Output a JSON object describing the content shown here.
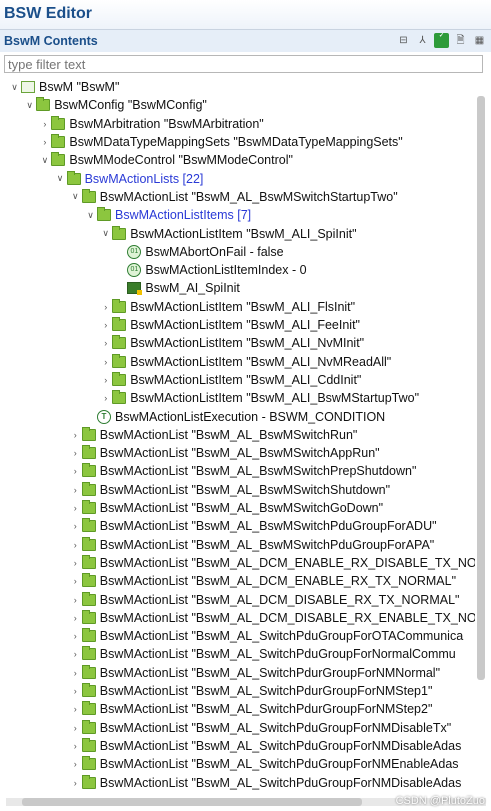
{
  "window": {
    "title": "BSW Editor"
  },
  "panel": {
    "title": "BswM Contents",
    "filter_placeholder": "type filter text"
  },
  "toolbar_icons": [
    "collapse-icon",
    "link-icon",
    "validate-icon",
    "file-icon",
    "layout-icon"
  ],
  "toolbar_labels": [
    "⊟",
    "⅄",
    "✓",
    "🗎",
    "▦"
  ],
  "tree": [
    {
      "label": "BswM \"BswM\"",
      "indent": 0,
      "tw": "∨",
      "icon": "container"
    },
    {
      "label": "BswMConfig \"BswMConfig\"",
      "indent": 1,
      "tw": "∨",
      "icon": "folder"
    },
    {
      "label": "BswMArbitration \"BswMArbitration\"",
      "indent": 2,
      "tw": "›",
      "icon": "folder"
    },
    {
      "label": "BswMDataTypeMappingSets \"BswMDataTypeMappingSets\"",
      "indent": 2,
      "tw": "›",
      "icon": "folder"
    },
    {
      "label": "BswMModeControl \"BswMModeControl\"",
      "indent": 2,
      "tw": "∨",
      "icon": "folder"
    },
    {
      "label": "BswMActionLists [22]",
      "indent": 3,
      "tw": "∨",
      "icon": "folder",
      "blue": true
    },
    {
      "label": "BswMActionList \"BswM_AL_BswMSwitchStartupTwo\"",
      "indent": 4,
      "tw": "∨",
      "icon": "folder"
    },
    {
      "label": "BswMActionListItems [7]",
      "indent": 5,
      "tw": "∨",
      "icon": "folder",
      "blue": true
    },
    {
      "label": "BswMActionListItem \"BswM_ALI_SpiInit\"",
      "indent": 6,
      "tw": "∨",
      "icon": "folder"
    },
    {
      "label": "BswMAbortOnFail - false",
      "indent": 7,
      "tw": "",
      "icon": "param"
    },
    {
      "label": "BswMActionListItemIndex - 0",
      "indent": 7,
      "tw": "",
      "icon": "param"
    },
    {
      "label": "BswM_AI_SpiInit",
      "indent": 7,
      "tw": "",
      "icon": "ref"
    },
    {
      "label": "BswMActionListItem \"BswM_ALI_FlsInit\"",
      "indent": 6,
      "tw": "›",
      "icon": "folder"
    },
    {
      "label": "BswMActionListItem \"BswM_ALI_FeeInit\"",
      "indent": 6,
      "tw": "›",
      "icon": "folder"
    },
    {
      "label": "BswMActionListItem \"BswM_ALI_NvMInit\"",
      "indent": 6,
      "tw": "›",
      "icon": "folder"
    },
    {
      "label": "BswMActionListItem \"BswM_ALI_NvMReadAll\"",
      "indent": 6,
      "tw": "›",
      "icon": "folder"
    },
    {
      "label": "BswMActionListItem \"BswM_ALI_CddInit\"",
      "indent": 6,
      "tw": "›",
      "icon": "folder"
    },
    {
      "label": "BswMActionListItem \"BswM_ALI_BswMStartupTwo\"",
      "indent": 6,
      "tw": "›",
      "icon": "folder"
    },
    {
      "label": "BswMActionListExecution - BSWM_CONDITION",
      "indent": 5,
      "tw": "",
      "icon": "enum"
    },
    {
      "label": "BswMActionList \"BswM_AL_BswMSwitchRun\"",
      "indent": 4,
      "tw": "›",
      "icon": "folder"
    },
    {
      "label": "BswMActionList \"BswM_AL_BswMSwitchAppRun\"",
      "indent": 4,
      "tw": "›",
      "icon": "folder"
    },
    {
      "label": "BswMActionList \"BswM_AL_BswMSwitchPrepShutdown\"",
      "indent": 4,
      "tw": "›",
      "icon": "folder"
    },
    {
      "label": "BswMActionList \"BswM_AL_BswMSwitchShutdown\"",
      "indent": 4,
      "tw": "›",
      "icon": "folder"
    },
    {
      "label": "BswMActionList \"BswM_AL_BswMSwitchGoDown\"",
      "indent": 4,
      "tw": "›",
      "icon": "folder"
    },
    {
      "label": "BswMActionList \"BswM_AL_BswMSwitchPduGroupForADU\"",
      "indent": 4,
      "tw": "›",
      "icon": "folder"
    },
    {
      "label": "BswMActionList \"BswM_AL_BswMSwitchPduGroupForAPA\"",
      "indent": 4,
      "tw": "›",
      "icon": "folder"
    },
    {
      "label": "BswMActionList \"BswM_AL_DCM_ENABLE_RX_DISABLE_TX_NOR",
      "indent": 4,
      "tw": "›",
      "icon": "folder"
    },
    {
      "label": "BswMActionList \"BswM_AL_DCM_ENABLE_RX_TX_NORMAL\"",
      "indent": 4,
      "tw": "›",
      "icon": "folder"
    },
    {
      "label": "BswMActionList \"BswM_AL_DCM_DISABLE_RX_TX_NORMAL\"",
      "indent": 4,
      "tw": "›",
      "icon": "folder"
    },
    {
      "label": "BswMActionList \"BswM_AL_DCM_DISABLE_RX_ENABLE_TX_NOR",
      "indent": 4,
      "tw": "›",
      "icon": "folder"
    },
    {
      "label": "BswMActionList \"BswM_AL_SwitchPduGroupForOTACommunica",
      "indent": 4,
      "tw": "›",
      "icon": "folder"
    },
    {
      "label": "BswMActionList \"BswM_AL_SwitchPduGroupForNormalCommu",
      "indent": 4,
      "tw": "›",
      "icon": "folder"
    },
    {
      "label": "BswMActionList \"BswM_AL_SwitchPdurGroupForNMNormal\"",
      "indent": 4,
      "tw": "›",
      "icon": "folder"
    },
    {
      "label": "BswMActionList \"BswM_AL_SwitchPdurGroupForNMStep1\"",
      "indent": 4,
      "tw": "›",
      "icon": "folder"
    },
    {
      "label": "BswMActionList \"BswM_AL_SwitchPdurGroupForNMStep2\"",
      "indent": 4,
      "tw": "›",
      "icon": "folder"
    },
    {
      "label": "BswMActionList \"BswM_AL_SwitchPduGroupForNMDisableTx\"",
      "indent": 4,
      "tw": "›",
      "icon": "folder"
    },
    {
      "label": "BswMActionList \"BswM_AL_SwitchPduGroupForNMDisableAdas",
      "indent": 4,
      "tw": "›",
      "icon": "folder"
    },
    {
      "label": "BswMActionList \"BswM_AL_SwitchPduGroupForNMEnableAdas",
      "indent": 4,
      "tw": "›",
      "icon": "folder"
    },
    {
      "label": "BswMActionList \"BswM_AL_SwitchPduGroupForNMDisableAdas",
      "indent": 4,
      "tw": "›",
      "icon": "folder"
    }
  ],
  "watermark": "CSDN @PlutoZuo"
}
